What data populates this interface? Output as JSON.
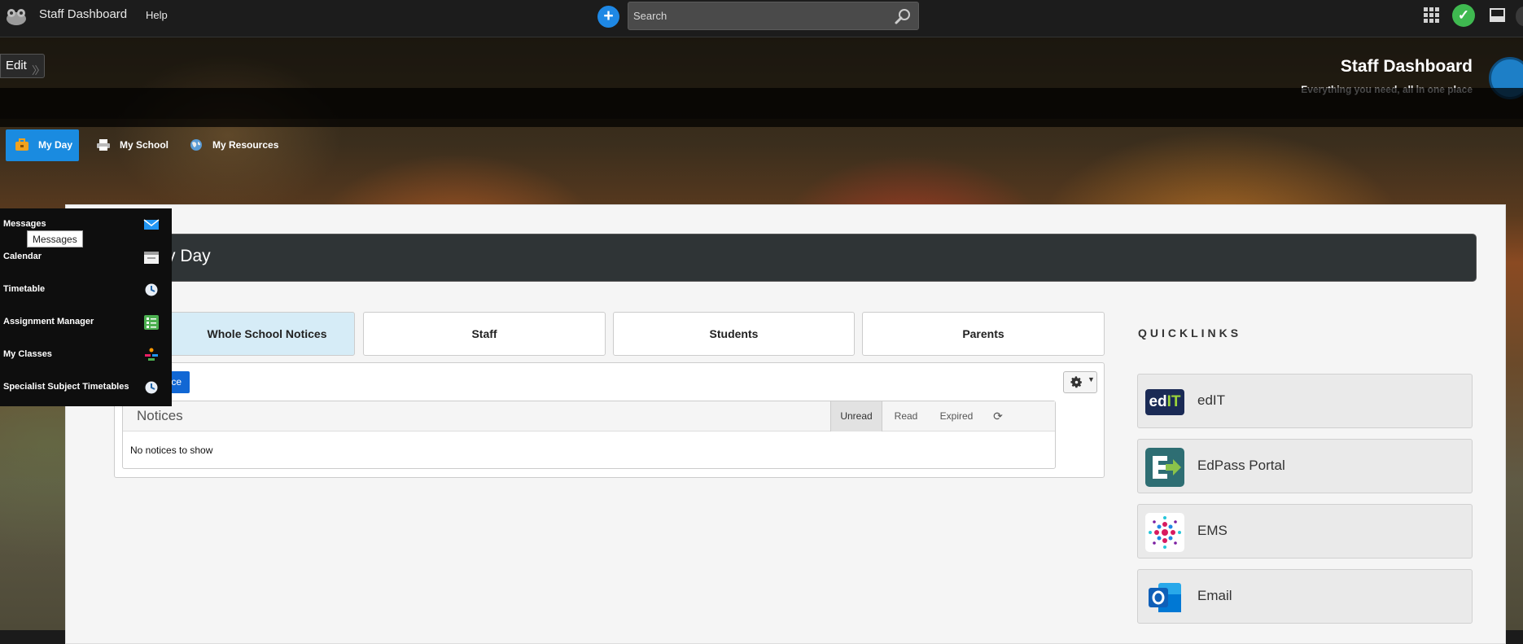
{
  "topbar": {
    "app_title": "Staff Dashboard",
    "help": "Help",
    "search_placeholder": "Search"
  },
  "banner": {
    "edit": "Edit",
    "title": "Staff Dashboard",
    "subtitle": "Everything you need, all in one place"
  },
  "nav": {
    "items": [
      {
        "label": "My Day",
        "icon": "briefcase-icon",
        "active": true
      },
      {
        "label": "My School",
        "icon": "printer-icon"
      },
      {
        "label": "My Resources",
        "icon": "globe-icon"
      }
    ]
  },
  "flyout": {
    "items": [
      {
        "label": "Messages",
        "icon": "mail-icon"
      },
      {
        "label": "Calendar",
        "icon": "calendar-icon"
      },
      {
        "label": "Timetable",
        "icon": "clock-icon"
      },
      {
        "label": "Assignment Manager",
        "icon": "checklist-icon"
      },
      {
        "label": "My Classes",
        "icon": "classes-icon"
      },
      {
        "label": "Specialist Subject Timetables",
        "icon": "clock-icon"
      }
    ],
    "tooltip": "Messages"
  },
  "page": {
    "header_title": "y Day"
  },
  "tabs": [
    "Whole School Notices",
    "Staff",
    "Students",
    "Parents"
  ],
  "notices": {
    "add_button_partial": "ce",
    "title": "Notices",
    "filters": [
      "Unread",
      "Read",
      "Expired"
    ],
    "empty": "No notices to show"
  },
  "quicklinks": {
    "heading": "QUICKLINKS",
    "items": [
      {
        "label": "edIT",
        "logo_text": "edIT"
      },
      {
        "label": "EdPass Portal"
      },
      {
        "label": "EMS"
      },
      {
        "label": "Email"
      }
    ]
  },
  "colors": {
    "accent_blue": "#1a8be0",
    "status_green": "#3fb950",
    "dark_header": "#2f3436"
  }
}
